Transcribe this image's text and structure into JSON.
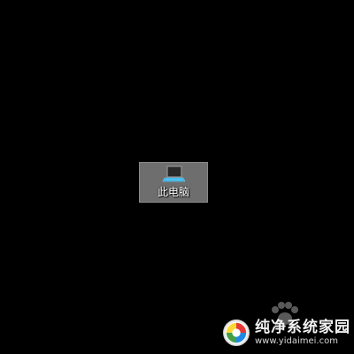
{
  "desktop": {
    "icons": [
      {
        "label": "此电脑",
        "icon": "this-pc-icon",
        "selected": true
      }
    ]
  },
  "watermark": {
    "title": "纯净系统家园",
    "url": "www.yidaimei.com",
    "logo": "watermark-logo-icon"
  },
  "colors": {
    "background": "#000000",
    "selection": "#6e6e6e",
    "label_text": "#ffffff"
  }
}
